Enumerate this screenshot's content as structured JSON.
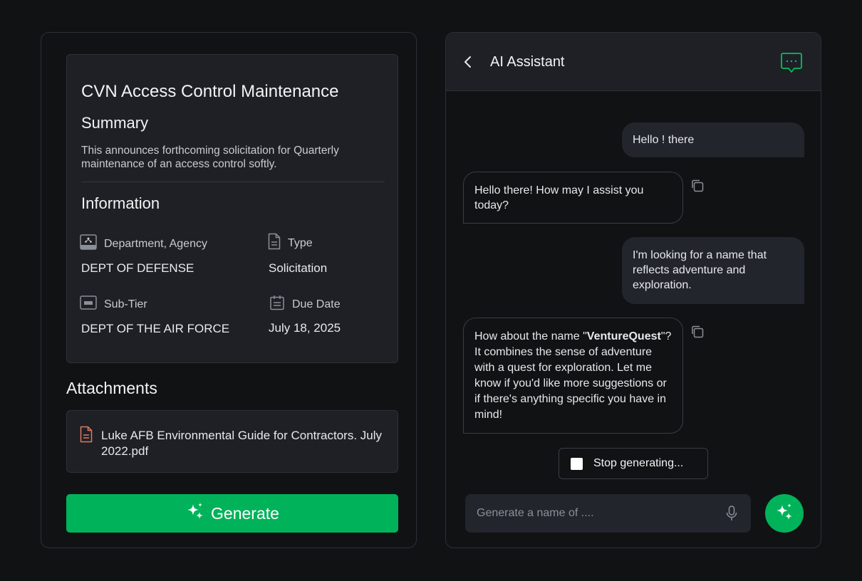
{
  "opportunity": {
    "title": "CVN Access Control Maintenance",
    "summary_heading": "Summary",
    "summary_text": "This announces forthcoming solicitation for Quarterly maintenance of an access control softly.",
    "information_heading": "Information",
    "fields": {
      "department": {
        "label": "Department, Agency",
        "value": "DEPT OF DEFENSE",
        "icon": "department-icon"
      },
      "type": {
        "label": "Type",
        "value": "Solicitation",
        "icon": "document-icon"
      },
      "subtier": {
        "label": "Sub-Tier",
        "value": "DEPT OF THE AIR FORCE",
        "icon": "subtier-icon"
      },
      "due_date": {
        "label": "Due Date",
        "value": "July 18, 2025",
        "icon": "calendar-icon"
      }
    }
  },
  "attachments": {
    "heading": "Attachments",
    "items": [
      {
        "name": "Luke AFB Environmental Guide for Contractors. July 2022.pdf",
        "icon": "file-icon"
      }
    ]
  },
  "generate_button": {
    "label": "Generate",
    "icon": "sparkle-icon"
  },
  "assistant": {
    "title": "AI Assistant",
    "header_icon": "chat-bubble-icon",
    "messages": [
      {
        "role": "user",
        "text": "Hello ! there"
      },
      {
        "role": "assistant",
        "text": "Hello there! How may I assist you today?"
      },
      {
        "role": "user",
        "text": "I'm looking for a name that reflects adventure and exploration."
      },
      {
        "role": "assistant",
        "text_before": "How about the name \"",
        "bold": "VentureQuest",
        "text_after": "\"? It combines the sense of adventure with a quest for exploration. Let me know if you'd like more suggestions or if there's anything specific you have in mind!"
      }
    ],
    "stop_label": "Stop generating...",
    "input": {
      "placeholder": "Generate a name of ....",
      "value": ""
    }
  },
  "colors": {
    "accent": "#00b35a",
    "background": "#111214",
    "card": "#1e2026",
    "file_icon": "#e07a5f"
  }
}
